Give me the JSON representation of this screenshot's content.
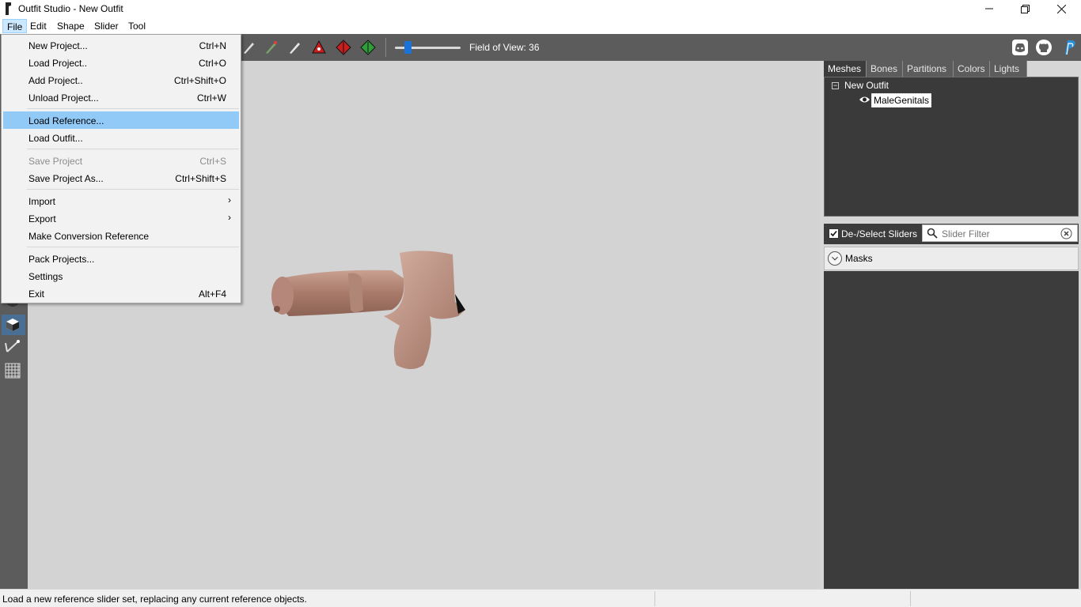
{
  "window": {
    "title": "Outfit Studio - New Outfit",
    "controls": [
      "minimize",
      "restore",
      "close"
    ]
  },
  "menubar": {
    "items": [
      "File",
      "Edit",
      "Shape",
      "Slider",
      "Tool"
    ],
    "active": "File"
  },
  "toolbar": {
    "fov_label": "Field of View: 36",
    "fov_value": 36,
    "social_icons": [
      "discord-icon",
      "github-icon",
      "paypal-icon"
    ]
  },
  "file_menu": {
    "items": [
      {
        "label": "New Project...",
        "shortcut": "Ctrl+N"
      },
      {
        "label": "Load Project..",
        "shortcut": "Ctrl+O"
      },
      {
        "label": "Add Project..",
        "shortcut": "Ctrl+Shift+O"
      },
      {
        "label": "Unload Project...",
        "shortcut": "Ctrl+W"
      },
      {
        "label": "Load Reference...",
        "shortcut": "",
        "highlighted": true
      },
      {
        "label": "Load Outfit...",
        "shortcut": ""
      },
      {
        "label": "Save Project",
        "shortcut": "Ctrl+S",
        "disabled": true
      },
      {
        "label": "Save Project As...",
        "shortcut": "Ctrl+Shift+S"
      },
      {
        "label": "Import",
        "shortcut": "",
        "submenu": true
      },
      {
        "label": "Export",
        "shortcut": "",
        "submenu": true
      },
      {
        "label": "Make Conversion Reference",
        "shortcut": ""
      },
      {
        "label": "Pack Projects...",
        "shortcut": ""
      },
      {
        "label": "Settings",
        "shortcut": ""
      },
      {
        "label": "Exit",
        "shortcut": "Alt+F4"
      }
    ]
  },
  "right_panel": {
    "tabs": [
      "Meshes",
      "Bones",
      "Partitions",
      "Colors",
      "Lights"
    ],
    "active_tab": "Meshes",
    "tree": {
      "root": "New Outfit",
      "meshes": [
        "MaleGenitals"
      ]
    },
    "slider_controls": {
      "select_label": "De-/Select Sliders",
      "filter_placeholder": "Slider Filter"
    },
    "masks_label": "Masks"
  },
  "statusbar": {
    "text": "Load a new reference slider set, replacing any current reference objects."
  },
  "colors": {
    "toolbar_bg": "#5c5c5c",
    "viewport_bg": "#d3d3d3",
    "menu_highlight": "#91c9f7",
    "panel_dark": "#3c3c3c"
  }
}
